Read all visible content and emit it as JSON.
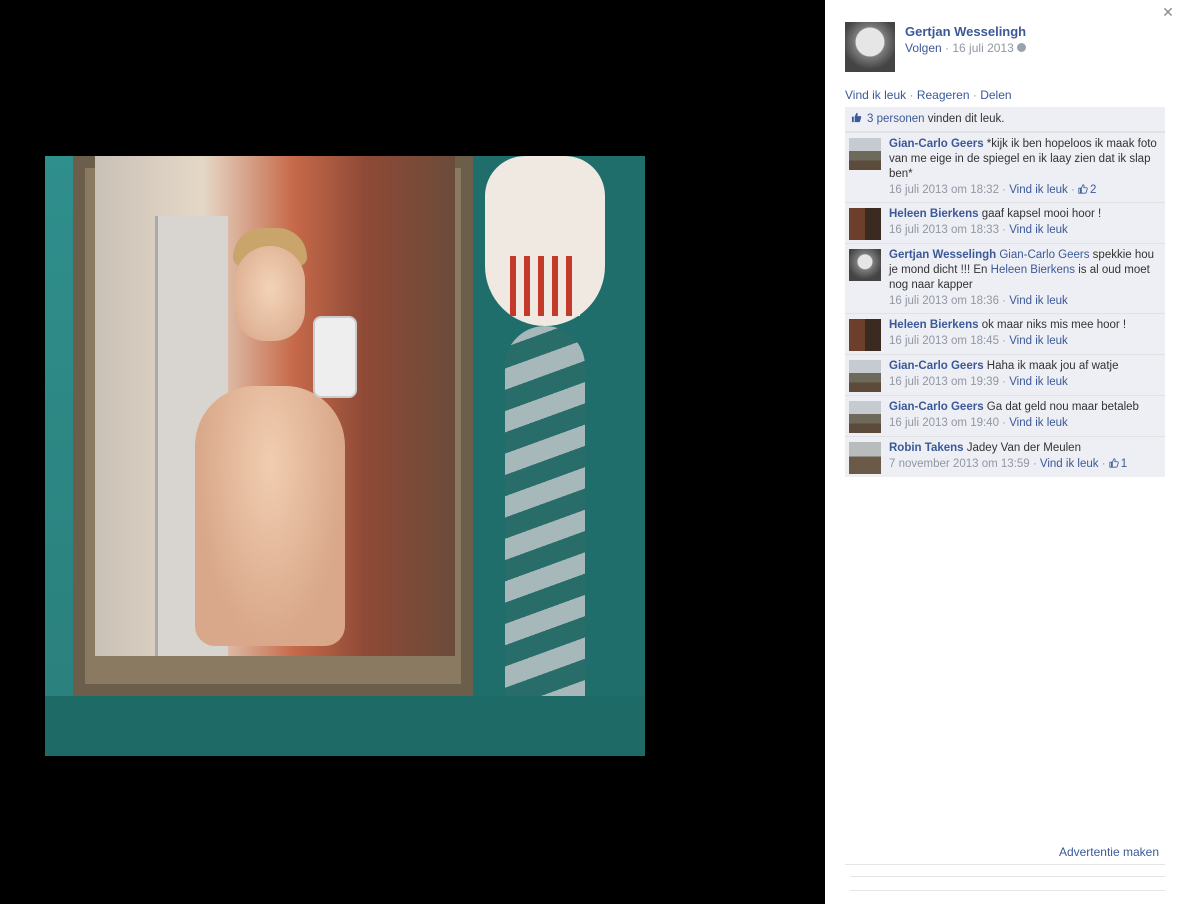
{
  "owner": {
    "name": "Gertjan Wesselingh",
    "follow": "Volgen",
    "separator": " · ",
    "date": "16 juli 2013"
  },
  "actions": {
    "like": "Vind ik leuk",
    "comment": "Reageren",
    "share": "Delen",
    "separator": " · "
  },
  "likes": {
    "count_link": "3 personen",
    "suffix": " vinden dit leuk."
  },
  "comments": [
    {
      "author": "Gian-Carlo Geers",
      "text": " *kijk ik ben hopeloos ik maak foto van me eige in de spiegel en ik laay zien dat ik slap ben*",
      "time": "16 juli 2013 om 18:32",
      "like": "Vind ik leuk",
      "likes": "2"
    },
    {
      "author": "Heleen Bierkens",
      "text": " gaaf kapsel mooi hoor !",
      "time": "16 juli 2013 om 18:33",
      "like": "Vind ik leuk"
    },
    {
      "author": "Gertjan Wesselingh",
      "mention1": "Gian-Carlo Geers",
      "text1": " spekkie hou je mond dicht !!! En ",
      "mention2": "Heleen Bierkens",
      "text2": " is al oud moet nog naar kapper",
      "time": "16 juli 2013 om 18:36",
      "like": "Vind ik leuk"
    },
    {
      "author": "Heleen Bierkens",
      "text": " ok maar niks mis mee hoor !",
      "time": "16 juli 2013 om 18:45",
      "like": "Vind ik leuk"
    },
    {
      "author": "Gian-Carlo Geers",
      "text": " Haha ik maak jou af watje",
      "time": "16 juli 2013 om 19:39",
      "like": "Vind ik leuk"
    },
    {
      "author": "Gian-Carlo Geers",
      "text": " Ga dat geld nou maar betaleb",
      "time": "16 juli 2013 om 19:40",
      "like": "Vind ik leuk"
    },
    {
      "author": "Robin Takens",
      "text": " Jadey Van der Meulen",
      "time": "7 november 2013 om 13:59",
      "like": "Vind ik leuk",
      "likes": "1"
    }
  ],
  "meta_sep": " · ",
  "footer": {
    "ad_link": "Advertentie maken"
  },
  "icons": {
    "close": "close-icon",
    "globe": "globe-icon",
    "thumb": "thumbs-up-icon"
  },
  "colors": {
    "link": "#3b5998",
    "muted": "#9197a3",
    "panel": "#edeff4"
  }
}
